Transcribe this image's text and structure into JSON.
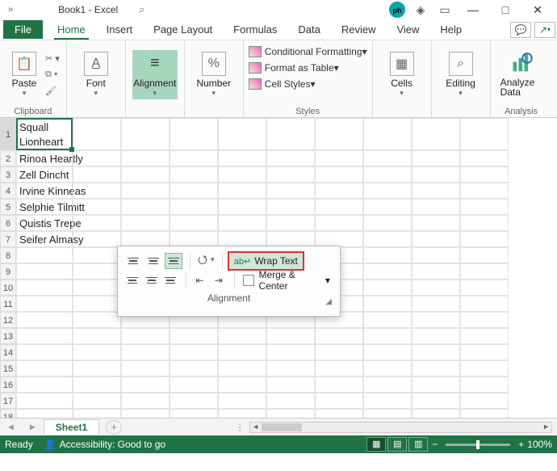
{
  "title": "Book1 - Excel",
  "tabs": {
    "file": "File",
    "items": [
      "Home",
      "Insert",
      "Page Layout",
      "Formulas",
      "Data",
      "Review",
      "View",
      "Help"
    ],
    "active": "Home"
  },
  "ribbon": {
    "clipboard": {
      "label": "Clipboard",
      "paste": "Paste"
    },
    "font": {
      "label": "Font",
      "btn": "Font"
    },
    "alignment": {
      "label": "Alignment",
      "btn": "Alignment"
    },
    "number": {
      "label": "Number",
      "btn": "Number"
    },
    "styles": {
      "label": "Styles",
      "cond": "Conditional Formatting",
      "table": "Format as Table",
      "cell": "Cell Styles"
    },
    "cells": {
      "label": "Cells",
      "btn": "Cells"
    },
    "editing": {
      "label": "Editing",
      "btn": "Editing"
    },
    "analysis": {
      "label": "Analysis",
      "btn": "Analyze Data"
    }
  },
  "popup": {
    "wrap": "Wrap Text",
    "merge": "Merge & Center",
    "label": "Alignment"
  },
  "rows": [
    "Squall Lionheart",
    "Rinoa Heartly",
    "Zell Dincht",
    "Irvine Kinneas",
    "Selphie Tilmitt",
    "Quistis Trepe",
    "Seifer Almasy"
  ],
  "sheet": {
    "name": "Sheet1"
  },
  "status": {
    "ready": "Ready",
    "accessibility": "Accessibility: Good to go",
    "zoom": "100%"
  }
}
